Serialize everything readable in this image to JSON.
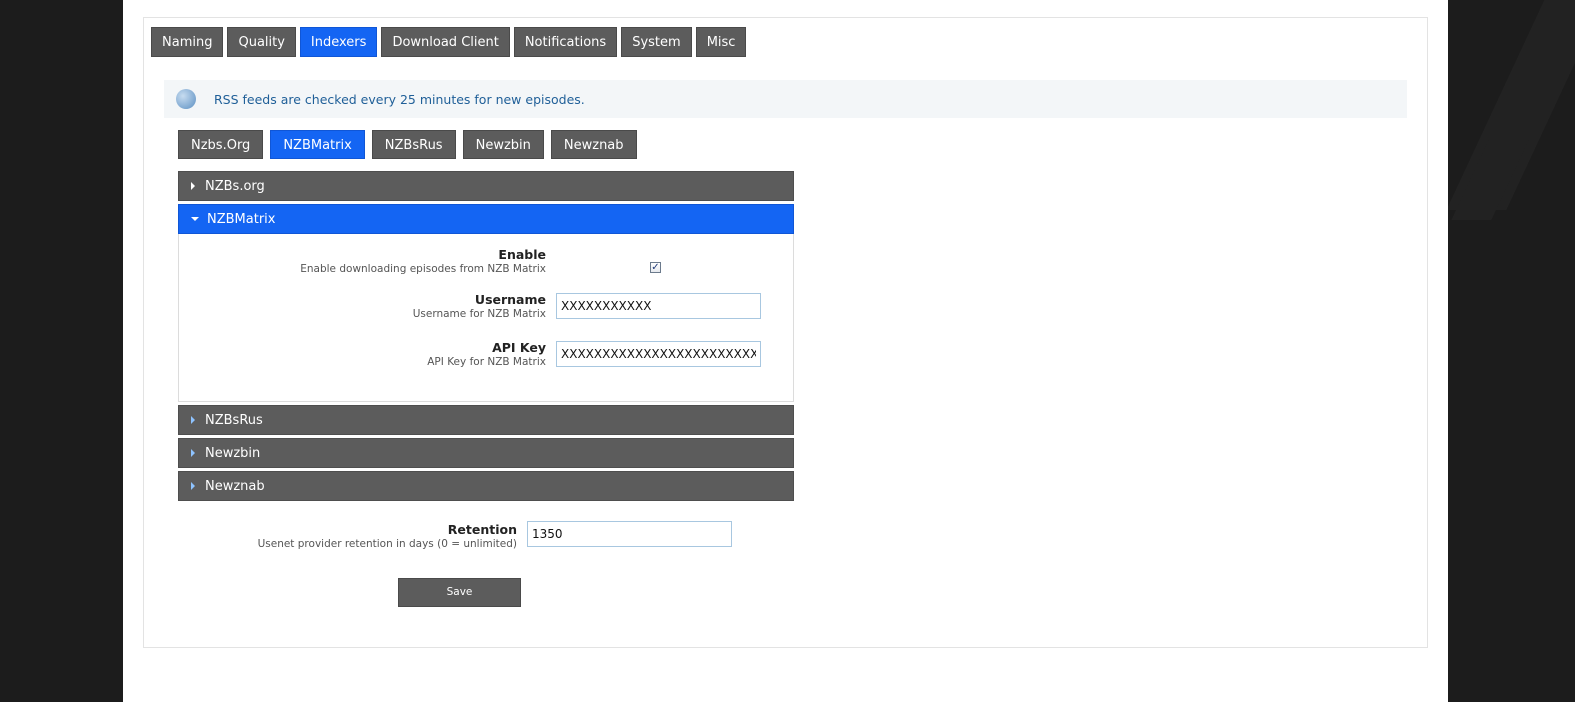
{
  "main_tabs": [
    {
      "label": "Naming",
      "active": false
    },
    {
      "label": "Quality",
      "active": false
    },
    {
      "label": "Indexers",
      "active": true
    },
    {
      "label": "Download Client",
      "active": false
    },
    {
      "label": "Notifications",
      "active": false
    },
    {
      "label": "System",
      "active": false
    },
    {
      "label": "Misc",
      "active": false
    }
  ],
  "info": {
    "icon": "info-bubble-icon",
    "text": "RSS feeds are checked every 25 minutes for new episodes."
  },
  "indexer_tabs": [
    {
      "label": "Nzbs.Org",
      "active": false
    },
    {
      "label": "NZBMatrix",
      "active": true
    },
    {
      "label": "NZBsRus",
      "active": false
    },
    {
      "label": "Newzbin",
      "active": false
    },
    {
      "label": "Newznab",
      "active": false
    }
  ],
  "accordion": {
    "nzbsorg": {
      "label": "NZBs.org",
      "expanded": false
    },
    "nzbmatrix": {
      "label": "NZBMatrix",
      "expanded": true,
      "enable": {
        "title": "Enable",
        "desc": "Enable downloading episodes from NZB Matrix",
        "checked": true
      },
      "username": {
        "title": "Username",
        "desc": "Username for NZB Matrix",
        "value": "XXXXXXXXXXX"
      },
      "apikey": {
        "title": "API Key",
        "desc": "API Key for NZB Matrix",
        "value": "XXXXXXXXXXXXXXXXXXXXXXXX"
      }
    },
    "nzbsrus": {
      "label": "NZBsRus",
      "expanded": false
    },
    "newzbin": {
      "label": "Newzbin",
      "expanded": false
    },
    "newznab": {
      "label": "Newznab",
      "expanded": false
    }
  },
  "retention": {
    "title": "Retention",
    "desc": "Usenet provider retention in days (0 = unlimited)",
    "value": "1350"
  },
  "save_label": "Save",
  "colors": {
    "active_tab": "#1465f3",
    "inactive_tab": "#5c5c5c",
    "info_text": "#1f5f98",
    "info_bg": "#f3f6f8",
    "outer_bg": "#1c1c1c"
  }
}
